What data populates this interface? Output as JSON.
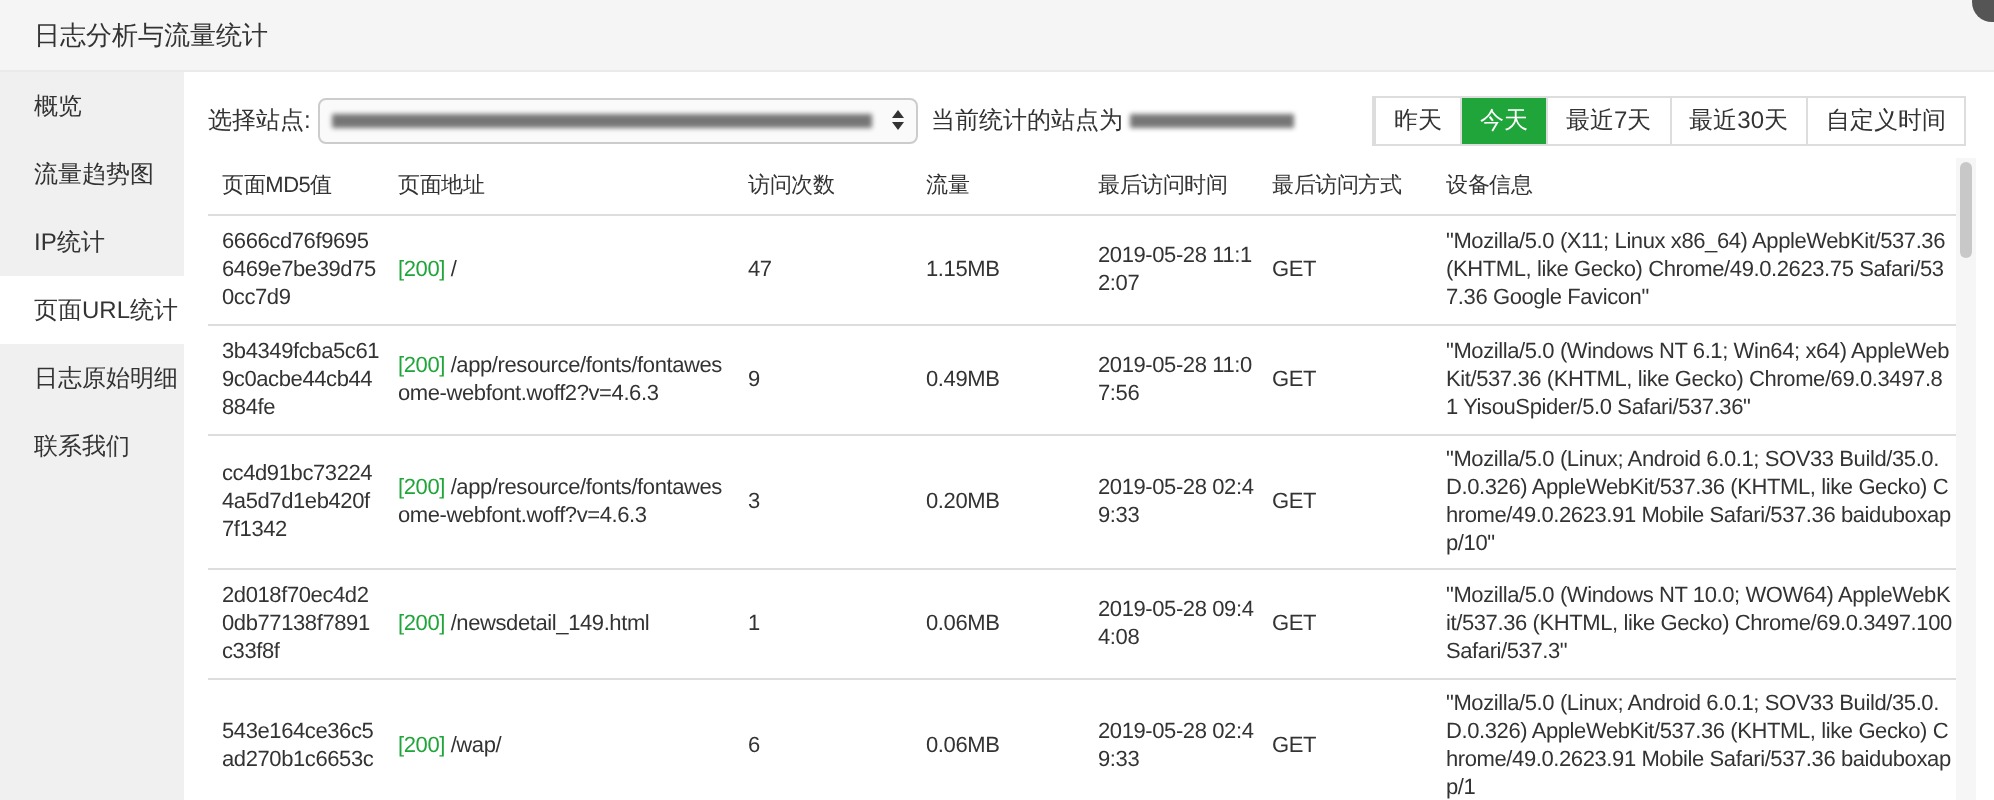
{
  "window": {
    "title": "日志分析与流量统计"
  },
  "sidebar": {
    "items": [
      {
        "label": "概览",
        "selected": false
      },
      {
        "label": "流量趋势图",
        "selected": false
      },
      {
        "label": "IP统计",
        "selected": false
      },
      {
        "label": "页面URL统计",
        "selected": true
      },
      {
        "label": "日志原始明细",
        "selected": false
      },
      {
        "label": "联系我们",
        "selected": false
      }
    ]
  },
  "toolbar": {
    "site_label": "选择站点:",
    "current_site_label": "当前统计的站点为"
  },
  "date_ranges": [
    {
      "label": "昨天",
      "selected": false
    },
    {
      "label": "今天",
      "selected": true
    },
    {
      "label": "最近7天",
      "selected": false
    },
    {
      "label": "最近30天",
      "selected": false
    },
    {
      "label": "自定义时间",
      "selected": false
    }
  ],
  "table": {
    "columns": [
      "页面MD5值",
      "页面地址",
      "访问次数",
      "流量",
      "最后访问时间",
      "最后访问方式",
      "设备信息"
    ],
    "rows": [
      {
        "md5": "6666cd76f96956469e7be39d750cc7d9",
        "status": "[200]",
        "path": "/",
        "visits": "47",
        "traffic": "1.15MB",
        "last_visit": "2019-05-28 11:12:07",
        "method": "GET",
        "user_agent": "\"Mozilla/5.0 (X11; Linux x86_64) AppleWebKit/537.36 (KHTML, like Gecko) Chrome/49.0.2623.75 Safari/537.36 Google Favicon\""
      },
      {
        "md5": "3b4349fcba5c619c0acbe44cb44884fe",
        "status": "[200]",
        "path": "/app/resource/fonts/fontawesome-webfont.woff2?v=4.6.3",
        "visits": "9",
        "traffic": "0.49MB",
        "last_visit": "2019-05-28 11:07:56",
        "method": "GET",
        "user_agent": "\"Mozilla/5.0 (Windows NT 6.1; Win64; x64) AppleWebKit/537.36 (KHTML, like Gecko) Chrome/69.0.3497.81 YisouSpider/5.0 Safari/537.36\""
      },
      {
        "md5": "cc4d91bc732244a5d7d1eb420f7f1342",
        "status": "[200]",
        "path": "/app/resource/fonts/fontawesome-webfont.woff?v=4.6.3",
        "visits": "3",
        "traffic": "0.20MB",
        "last_visit": "2019-05-28 02:49:33",
        "method": "GET",
        "user_agent": "\"Mozilla/5.0 (Linux; Android 6.0.1; SOV33 Build/35.0.D.0.326) AppleWebKit/537.36 (KHTML, like Gecko) Chrome/49.0.2623.91 Mobile Safari/537.36 baiduboxapp/10\""
      },
      {
        "md5": "2d018f70ec4d20db77138f7891c33f8f",
        "status": "[200]",
        "path": "/newsdetail_149.html",
        "visits": "1",
        "traffic": "0.06MB",
        "last_visit": "2019-05-28 09:44:08",
        "method": "GET",
        "user_agent": "\"Mozilla/5.0 (Windows NT 10.0; WOW64) AppleWebKit/537.36 (KHTML, like Gecko) Chrome/69.0.3497.100 Safari/537.3\""
      },
      {
        "md5": "543e164ce36c5ad270b1c6653c",
        "status": "[200]",
        "path": "/wap/",
        "visits": "6",
        "traffic": "0.06MB",
        "last_visit": "2019-05-28 02:49:33",
        "method": "GET",
        "user_agent": "\"Mozilla/5.0 (Linux; Android 6.0.1; SOV33 Build/35.0.D.0.326) AppleWebKit/537.36 (KHTML, like Gecko) Chrome/49.0.2623.91 Mobile Safari/537.36 baiduboxapp/1"
      }
    ]
  }
}
